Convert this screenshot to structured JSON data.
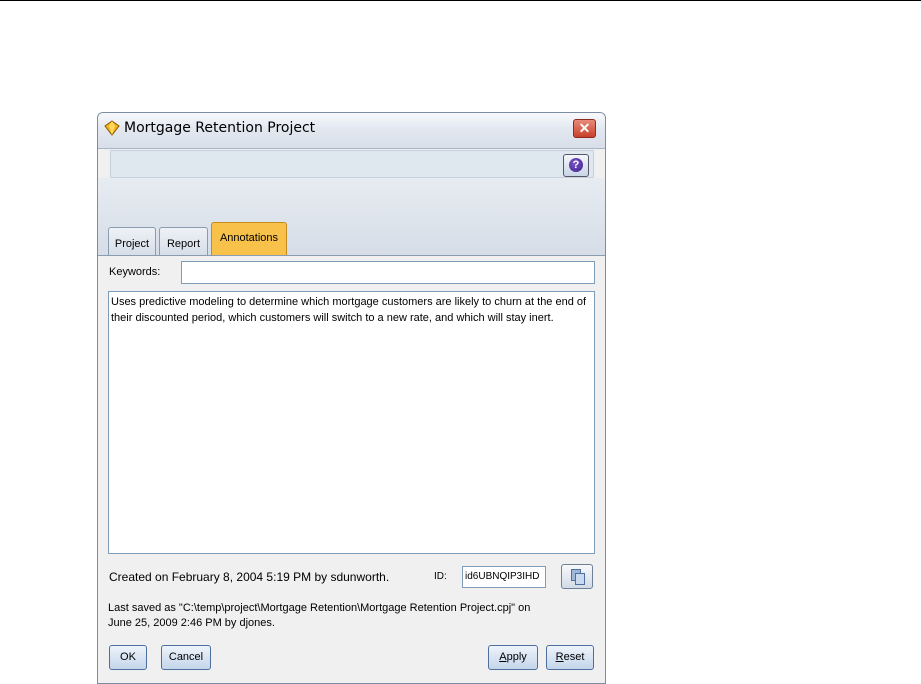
{
  "window": {
    "title": "Mortgage Retention Project",
    "close_glyph": "✕",
    "help_glyph": "?"
  },
  "tabs": [
    {
      "label": "Project",
      "active": false
    },
    {
      "label": "Report",
      "active": false
    },
    {
      "label": "Annotations",
      "active": true
    }
  ],
  "annotations": {
    "keywords_label": "Keywords:",
    "keywords_value": "",
    "notes": "Uses predictive modeling to determine which mortgage customers are likely to churn at the end of their discounted period, which customers will switch to a new rate, and which will stay inert."
  },
  "footer": {
    "created": "Created on February 8, 2004 5:19 PM by sdunworth.",
    "id_label": "ID:",
    "id_value": "id6UBNQIP3IHD",
    "saved_line1": "Last saved as \"C:\\temp\\project\\Mortgage Retention\\Mortgage Retention Project.cpj\" on",
    "saved_line2": "June 25, 2009 2:46 PM by djones."
  },
  "buttons": {
    "ok": "OK",
    "cancel": "Cancel",
    "apply_u": "A",
    "apply_rest": "pply",
    "reset_u": "R",
    "reset_rest": "eset"
  },
  "icons": {
    "title": "project-diamond-icon",
    "close": "close-icon",
    "help": "help-icon",
    "copy": "copy-icon"
  },
  "colors": {
    "active_tab": "#f7c14a",
    "title_bar": "#e3e8f0",
    "close_button": "#c8412a"
  }
}
